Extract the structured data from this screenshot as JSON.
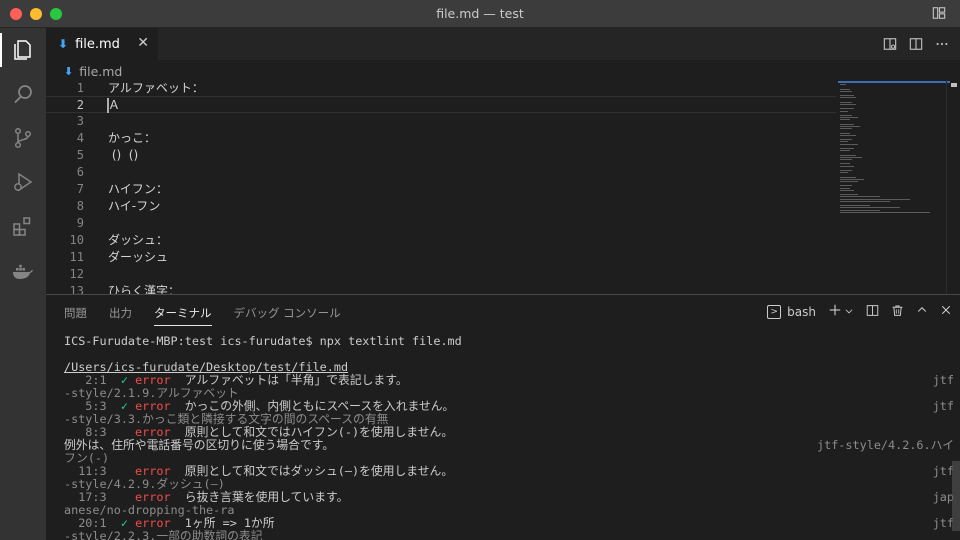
{
  "window": {
    "title": "file.md — test"
  },
  "tab": {
    "label": "file.md",
    "close_glyph": "✕"
  },
  "breadcrumb": {
    "file": "file.md"
  },
  "editor": {
    "lines": [
      {
        "no": "1",
        "text": "アルファベット："
      },
      {
        "no": "2",
        "text": "Ａ"
      },
      {
        "no": "3",
        "text": ""
      },
      {
        "no": "4",
        "text": "かっこ："
      },
      {
        "no": "5",
        "text": " ()  ()"
      },
      {
        "no": "6",
        "text": ""
      },
      {
        "no": "7",
        "text": "ハイフン："
      },
      {
        "no": "8",
        "text": "ハイ-フン"
      },
      {
        "no": "9",
        "text": ""
      },
      {
        "no": "10",
        "text": "ダッシュ："
      },
      {
        "no": "11",
        "text": "ダーッシュ"
      },
      {
        "no": "12",
        "text": ""
      },
      {
        "no": "13",
        "text": "ひらく漢字："
      }
    ]
  },
  "panel": {
    "tabs": [
      "問題",
      "出力",
      "ターミナル",
      "デバッグ コンソール"
    ],
    "shell_label": "bash"
  },
  "terminal": {
    "prompt": "ICS-Furudate-MBP:test ics-furudate$ npx textlint file.md",
    "path": "/Users/ics-furudate/Desktop/test/file.md",
    "rows": [
      {
        "pos": "   2:1",
        "fix": "✓",
        "level": "error",
        "message": "アルファベットは「半角」で表記します。",
        "rule_head": "jtf",
        "rule_tail": "-style/2.1.9.アルファベット"
      },
      {
        "pos": "   5:3",
        "fix": "✓",
        "level": "error",
        "message": "かっこの外側、内側ともにスペースを入れません。",
        "rule_head": "jtf",
        "rule_tail": "-style/3.3.かっこ類と隣接する文字の間のスペースの有無"
      },
      {
        "pos": "   8:3",
        "fix": "",
        "level": "error",
        "message": "原則として和文ではハイフン(-)を使用しません。",
        "message2": "例外は、住所や電話番号の区切りに使う場合です。",
        "rule_head": "jtf-style/4.2.6.ハイ",
        "rule_tail": "フン(-)"
      },
      {
        "pos": "  11:3",
        "fix": "",
        "level": "error",
        "message": "原則として和文ではダッシュ(―)を使用しません。",
        "rule_head": "jtf",
        "rule_tail": "-style/4.2.9.ダッシュ(―)"
      },
      {
        "pos": "  17:3",
        "fix": "",
        "level": "error",
        "message": "ら抜き言葉を使用しています。",
        "rule_head": "jap",
        "rule_tail": "anese/no-dropping-the-ra"
      },
      {
        "pos": "  20:1",
        "fix": "✓",
        "level": "error",
        "message": "1ヶ所 => 1か所",
        "rule_head": "jtf",
        "rule_tail": "-style/2.2.3.一部の助数詞の表記"
      }
    ]
  }
}
